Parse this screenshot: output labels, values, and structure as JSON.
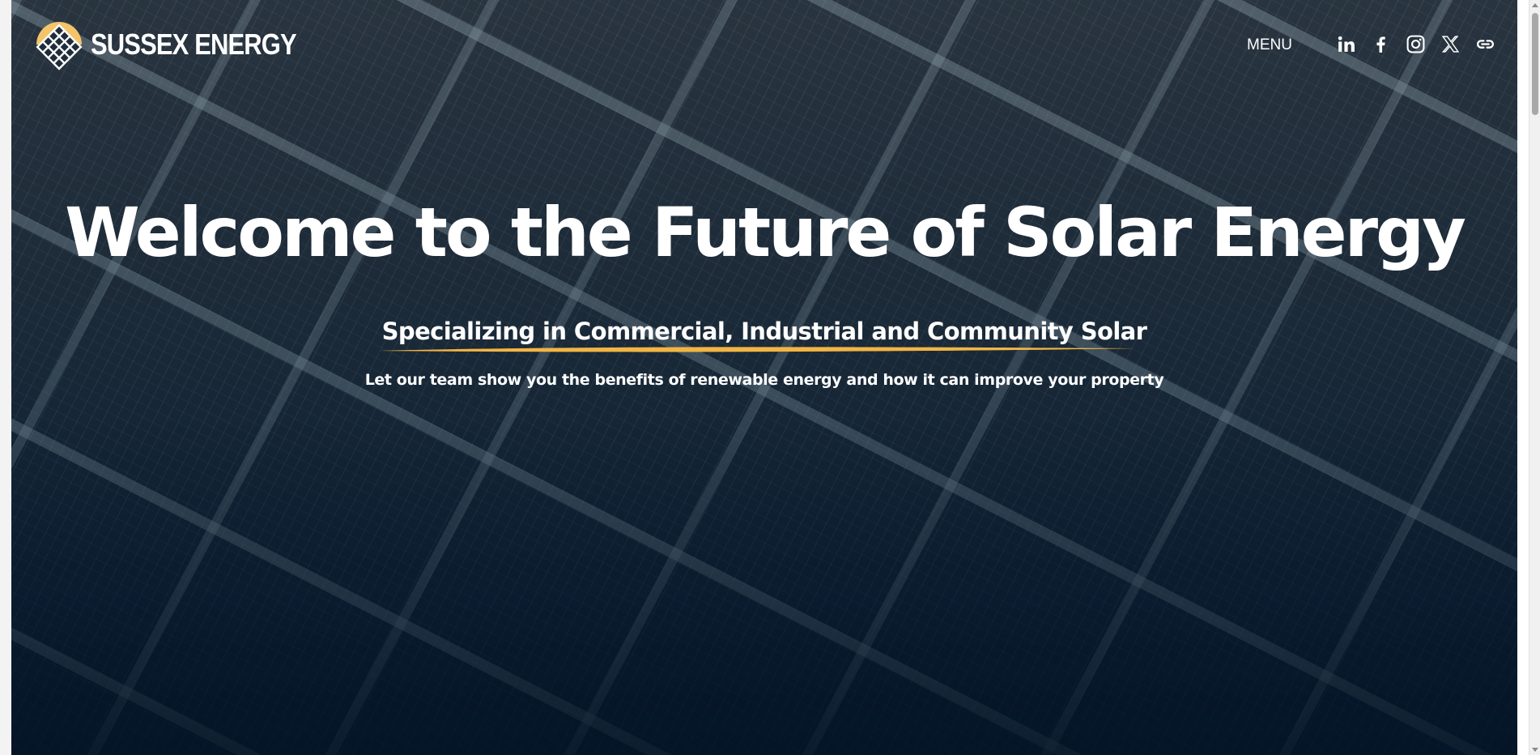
{
  "brand": {
    "name": "SUSSEX ENERGY",
    "logo_icon": "sun-solar-panel-logo",
    "sun_color": "#f4c46a"
  },
  "nav": {
    "menu_label": "MENU",
    "social_icons": [
      "linkedin-icon",
      "facebook-icon",
      "instagram-icon",
      "x-icon",
      "link-icon"
    ]
  },
  "hero": {
    "headline": "Welcome to the Future of Solar Energy",
    "subheadline": "Specializing in Commercial, Industrial and Community Solar",
    "tagline": "Let our team show you the benefits of renewable energy and how it can improve your property",
    "underline_color": "#f2b544",
    "background_icon": "solar-panel-background"
  },
  "colors": {
    "text": "#ffffff",
    "background_top": "#2a3540",
    "background_bottom": "#071a2c"
  }
}
